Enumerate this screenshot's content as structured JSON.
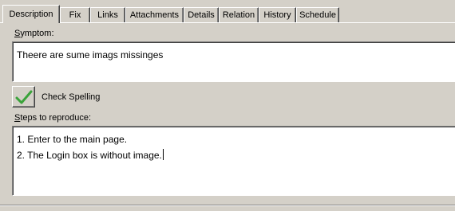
{
  "tabs": [
    {
      "label": "Description",
      "active": true
    },
    {
      "label": "Fix",
      "active": false
    },
    {
      "label": "Links",
      "active": false
    },
    {
      "label": "Attachments",
      "active": false
    },
    {
      "label": "Details",
      "active": false
    },
    {
      "label": "Relation",
      "active": false
    },
    {
      "label": "History",
      "active": false
    },
    {
      "label": "Schedule",
      "active": false
    }
  ],
  "symptom": {
    "label": "Symptom:",
    "value": "Theere are sume imags missinges"
  },
  "spell_check": {
    "label": "Check Spelling",
    "icon": "checkmark-icon",
    "icon_color": "#3aa33a"
  },
  "steps": {
    "label": "Steps to reproduce:",
    "lines": [
      "1. Enter to the main page.",
      "2. The Login box is without image."
    ]
  }
}
